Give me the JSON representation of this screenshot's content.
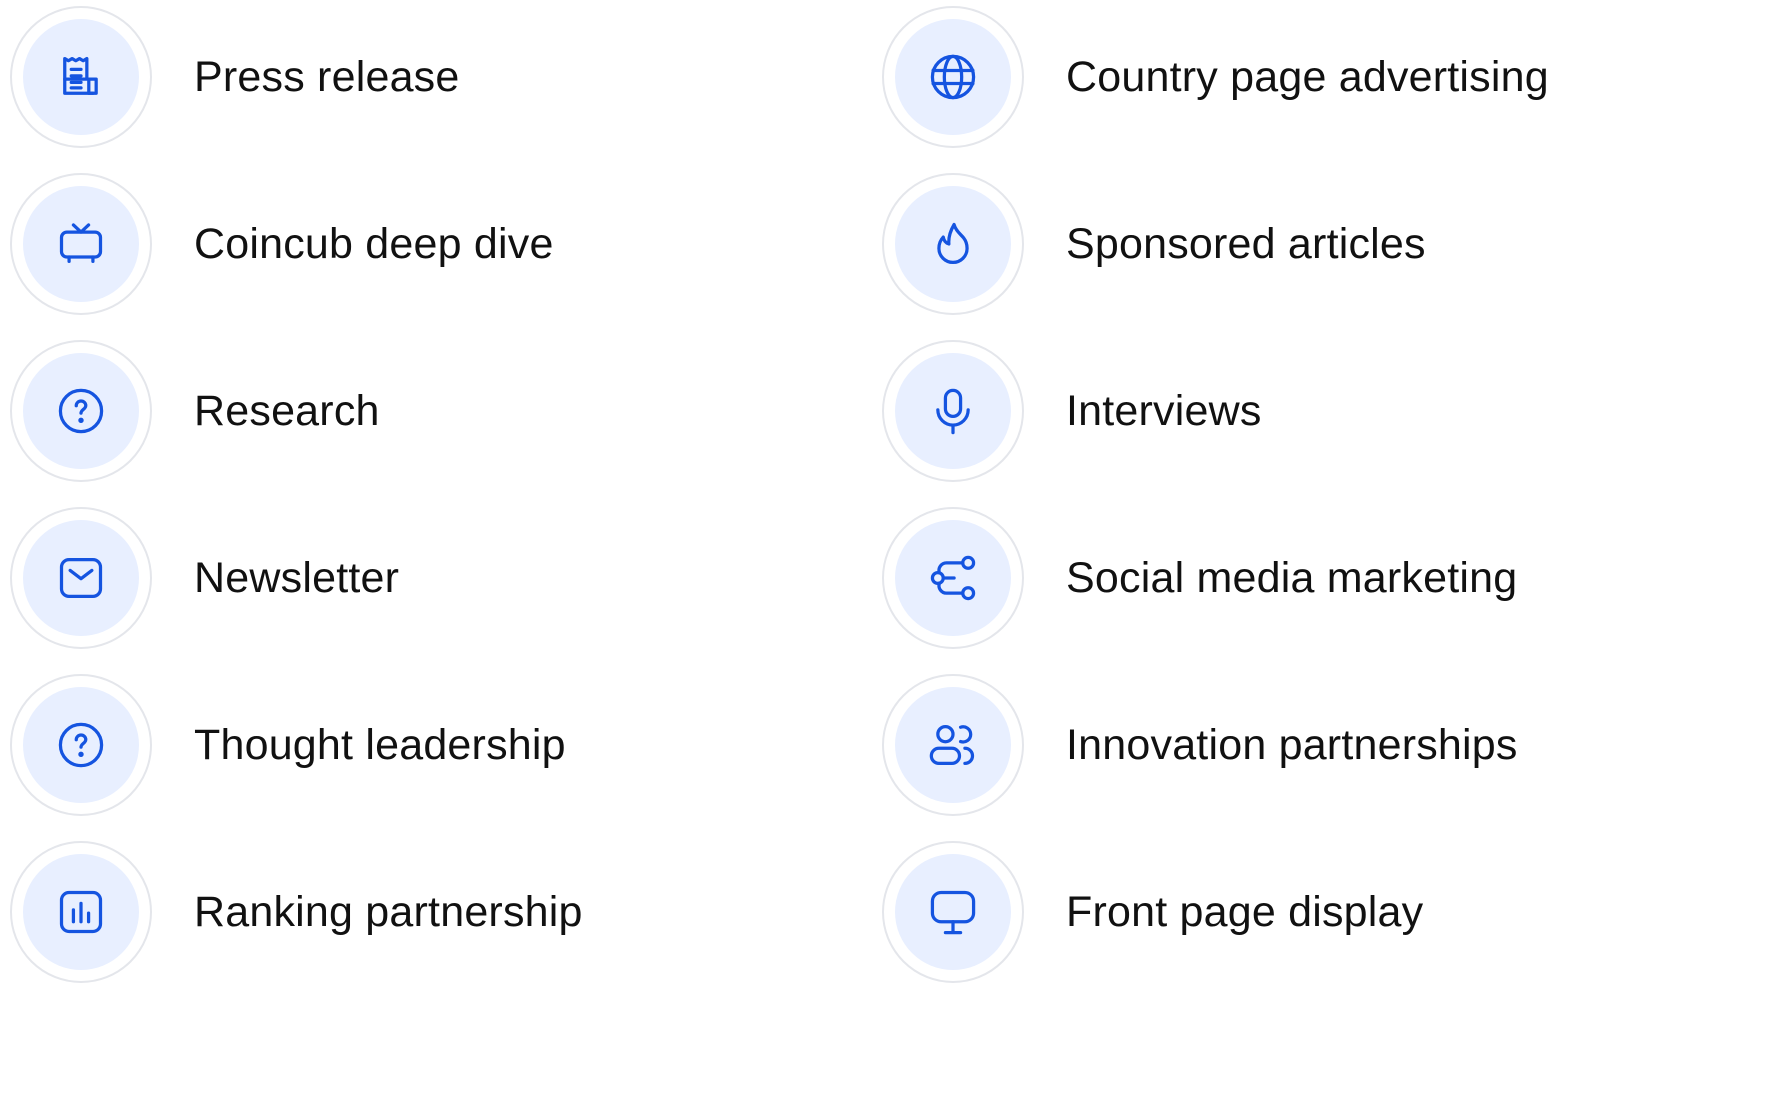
{
  "accent_color": "#1554e0",
  "icon_bg_color": "#e8efff",
  "services_left": [
    {
      "label": "Press release",
      "icon": "newspaper-icon"
    },
    {
      "label": "Coincub deep dive",
      "icon": "tv-icon"
    },
    {
      "label": "Research",
      "icon": "question-circle-icon"
    },
    {
      "label": "Newsletter",
      "icon": "mail-icon"
    },
    {
      "label": "Thought leadership",
      "icon": "question-circle-icon"
    },
    {
      "label": "Ranking partnership",
      "icon": "bar-chart-icon"
    }
  ],
  "services_right": [
    {
      "label": "Country page advertising",
      "icon": "globe-icon"
    },
    {
      "label": "Sponsored articles",
      "icon": "flame-icon"
    },
    {
      "label": "Interviews",
      "icon": "microphone-icon"
    },
    {
      "label": "Social media marketing",
      "icon": "share-nodes-icon"
    },
    {
      "label": "Innovation partnerships",
      "icon": "users-icon"
    },
    {
      "label": "Front page display",
      "icon": "monitor-icon"
    }
  ]
}
